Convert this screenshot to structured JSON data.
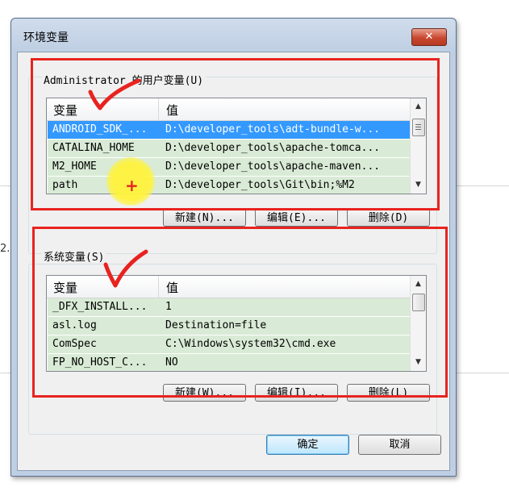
{
  "window": {
    "title": "环境变量",
    "close_glyph": "✕"
  },
  "page_fragment": "2.",
  "user_vars": {
    "label": "Administrator 的用户变量(U)",
    "columns": [
      "变量",
      "值"
    ],
    "rows": [
      {
        "name": "ANDROID_SDK_...",
        "value": "D:\\developer_tools\\adt-bundle-w...",
        "selected": true
      },
      {
        "name": "CATALINA_HOME",
        "value": "D:\\developer_tools\\apache-tomca..."
      },
      {
        "name": "M2_HOME",
        "value": "D:\\developer_tools\\apache-maven..."
      },
      {
        "name": "path",
        "value": "D:\\developer_tools\\Git\\bin;%M2"
      }
    ],
    "buttons": {
      "new": "新建(N)...",
      "edit": "编辑(E)...",
      "delete": "删除(D)"
    }
  },
  "system_vars": {
    "label": "系统变量(S)",
    "columns": [
      "变量",
      "值"
    ],
    "rows": [
      {
        "name": "_DFX_INSTALL...",
        "value": "1"
      },
      {
        "name": "asl.log",
        "value": "Destination=file"
      },
      {
        "name": "ComSpec",
        "value": "C:\\Windows\\system32\\cmd.exe"
      },
      {
        "name": "FP_NO_HOST_C...",
        "value": "NO"
      }
    ],
    "buttons": {
      "new": "新建(W)...",
      "edit": "编辑(I)...",
      "delete": "删除(L)"
    }
  },
  "footer": {
    "ok": "确定",
    "cancel": "取消"
  },
  "colors": {
    "annotation": "#e8231f",
    "selection": "#3399ff",
    "row_bg": "#d9ebd6",
    "cursor_highlight": "#fff33c"
  },
  "icons": {
    "scroll_up": "▲",
    "scroll_down": "▼",
    "plus": "+"
  }
}
